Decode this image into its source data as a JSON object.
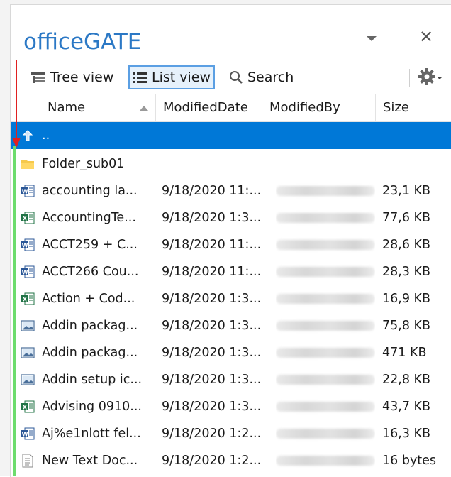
{
  "panel": {
    "title": "officeGATE"
  },
  "toolbar": {
    "tree_view_label": "Tree view",
    "list_view_label": "List view",
    "search_label": "Search"
  },
  "columns": {
    "name": "Name",
    "modified_date": "ModifiedDate",
    "modified_by": "ModifiedBy",
    "size": "Size"
  },
  "rows": [
    {
      "type": "up",
      "name": "..",
      "date": "",
      "size": ""
    },
    {
      "type": "folder",
      "name": "Folder_sub01",
      "date": "",
      "size": ""
    },
    {
      "type": "word",
      "name": "accounting la...",
      "date": "9/18/2020 11:...",
      "size": "23,1 KB"
    },
    {
      "type": "excel",
      "name": "AccountingTe...",
      "date": "9/18/2020 1:3...",
      "size": "77,6 KB"
    },
    {
      "type": "word",
      "name": "ACCT259 + C...",
      "date": "9/18/2020 11:...",
      "size": "28,6 KB"
    },
    {
      "type": "word",
      "name": "ACCT266 Cou...",
      "date": "9/18/2020 11:...",
      "size": "28,3 KB"
    },
    {
      "type": "excel",
      "name": "Action + Cod...",
      "date": "9/18/2020 1:3...",
      "size": "16,9 KB"
    },
    {
      "type": "image",
      "name": "Addin packag...",
      "date": "9/18/2020 1:3...",
      "size": "75,8 KB"
    },
    {
      "type": "image",
      "name": "Addin packag...",
      "date": "9/18/2020 1:3...",
      "size": "471 KB"
    },
    {
      "type": "image",
      "name": "Addin setup ic...",
      "date": "9/18/2020 1:3...",
      "size": "22,8 KB"
    },
    {
      "type": "excel",
      "name": "Advising 0910...",
      "date": "9/18/2020 1:3...",
      "size": "43,7 KB"
    },
    {
      "type": "word",
      "name": "Aj%e1nlott fel...",
      "date": "9/18/2020 1:2...",
      "size": "16,3 KB"
    },
    {
      "type": "text",
      "name": "New Text Doc...",
      "date": "9/18/2020 1:2...",
      "size": "16 bytes"
    }
  ],
  "colors": {
    "accent": "#2b78c5",
    "selected_row": "#0078d7",
    "indicator": "#6ddc6d",
    "annotation": "#e02020"
  }
}
